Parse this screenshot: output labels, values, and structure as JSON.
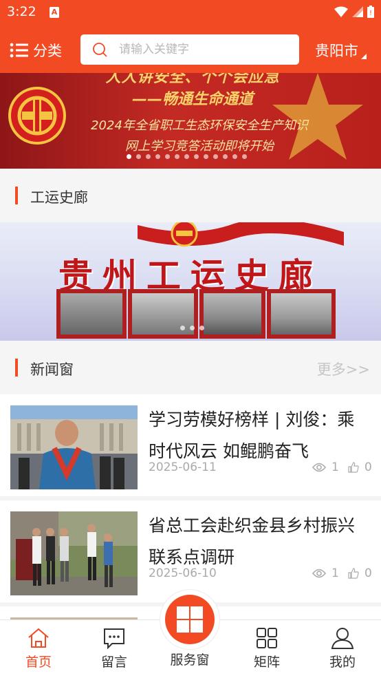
{
  "status_bar": {
    "time": "3:22",
    "notification_badge": "A"
  },
  "header": {
    "category_label": "分类",
    "search_placeholder": "请输入关键字",
    "city": "贵阳市"
  },
  "banner": {
    "headline_top": "人人讲安全、个个会应急",
    "headline_sub": "——畅通生命通道",
    "line1": "2024年全省职工生态环保安全生产知识",
    "line2": "网上学习竞答活动即将开始",
    "dot_count": 13,
    "active_dot": 0
  },
  "sections": {
    "history": {
      "title": "工运史廊"
    },
    "news": {
      "title": "新闻窗",
      "more": "更多>>"
    }
  },
  "history_banner": {
    "title": "贵州工运史廊"
  },
  "news_items": [
    {
      "title": "学习劳模好榜样 | 刘俊：乘时代风云  如鲲鹏奋飞",
      "date": "2025-06-11",
      "views": "1",
      "likes": "0"
    },
    {
      "title": "省总工会赴织金县乡村振兴联系点调研",
      "date": "2025-06-10",
      "views": "1",
      "likes": "0"
    }
  ],
  "tabbar": {
    "home": "首页",
    "message": "留言",
    "service": "服务窗",
    "matrix": "矩阵",
    "mine": "我的"
  },
  "colors": {
    "brand": "#f24a23",
    "muted": "#aaaaaa"
  }
}
